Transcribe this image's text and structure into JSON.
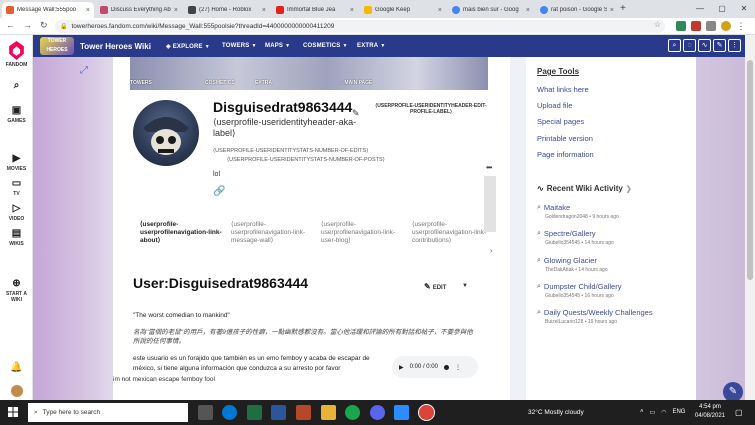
{
  "browser": {
    "tabs": [
      {
        "label": "Message Wall:555poo",
        "color": "#e65c2c",
        "active": true
      },
      {
        "label": "Discuss Everything Ab",
        "color": "#c14a6a",
        "active": false
      },
      {
        "label": "(27) Home - Roblox",
        "color": "#444444",
        "active": false
      },
      {
        "label": "Immortal Blue Jea",
        "color": "#e62117",
        "active": false
      },
      {
        "label": "Google Keep",
        "color": "#f6b800",
        "active": false
      },
      {
        "label": "mais bien sur - Goog",
        "color": "#4285f4",
        "active": false
      },
      {
        "label": "rat poison - Google S",
        "color": "#4285f4",
        "active": false
      }
    ],
    "url": "towerheroes.fandom.com/wiki/Message_Wall:555poolsie?threadId=4400000000000411209"
  },
  "fandom_rail": {
    "logo_text": "FANDOM",
    "items": [
      {
        "label": "GAMES",
        "icon": "gamepad-icon"
      },
      {
        "label": "MOVIES",
        "icon": "movie-icon"
      },
      {
        "label": "TV",
        "icon": "tv-icon"
      },
      {
        "label": "VIDEO",
        "icon": "video-icon"
      },
      {
        "label": "WIKIS",
        "icon": "wikis-icon"
      },
      {
        "label": "START A WIKI",
        "icon": "plus-circle-icon"
      }
    ]
  },
  "wiki": {
    "name": "Tower Heroes Wiki",
    "logo_text": "TOWER HEROES",
    "nav": [
      "EXPLORE",
      "TOWERS",
      "MAPS",
      "COSMETICS",
      "EXTRA"
    ]
  },
  "profile": {
    "banner_tabs": [
      "TOWERS",
      "COSMETICS",
      "EXTRA",
      "MAIN PAGE"
    ],
    "username": "Disguisedrat9863444",
    "aka_label": "⟨userprofile-useridentityheader-aka-label⟩",
    "edit_label": "⟨USERPROFILE-USERIDENTITYHEADER-EDIT-PROFILE-LABEL⟩",
    "stats_edits": "⟨USERPROFILE-USERIDENTITYSTATS-NUMBER-OF-EDITS⟩",
    "stats_posts": "⟨USERPROFILE-USERIDENTITYSTATS-NUMBER-OF-POSTS⟩",
    "bio": "lol",
    "nav": [
      "⟨userprofile-userprofilenavigation-link-about⟩",
      "⟨userprofile-userprofilenavigation-link-message-wall⟩",
      "⟨userprofile-userprofilenavigation-link-user-blog⟩",
      "⟨userprofile-userprofilenavigation-link-contributions⟩"
    ]
  },
  "page": {
    "title": "User:Disguisedrat9863444",
    "edit_label": "EDIT",
    "quote": "\"The worst comedian to mankind\"",
    "chinese": "名為\"當個的老鼠\"的用戶，有著9億孩子的性癖，一點幽默感都沒有。當心他活躍和評論的所有對話和帖子，不要參與他所說的任何事情。",
    "spanish": "este usuario es un forajido que también es un emo femboy y acaba de escapar de méxico, si tiene alguna información que conduzca a su arresto por favor",
    "audio_time": "0:00 / 0:00",
    "footnote": "im not mexican escape femboy fool"
  },
  "page_tools": {
    "title": "Page Tools",
    "links": [
      "What links here",
      "Upload file",
      "Special pages",
      "Printable version",
      "Page information"
    ]
  },
  "recent_activity": {
    "title": "Recent Wiki Activity",
    "items": [
      {
        "title": "Maitake",
        "meta": "Goldendragon2048 • 9 hours ago"
      },
      {
        "title": "Spectre/Gallery",
        "meta": "Giubello354545 • 14 hours ago"
      },
      {
        "title": "Glowing Glacier",
        "meta": "TheDakAttak • 14 hours ago"
      },
      {
        "title": "Dumpster Child/Gallery",
        "meta": "Giubello354545 • 16 hours ago"
      },
      {
        "title": "Daily Quests/Weekly Challenges",
        "meta": "BuizelLucario128 • 19 hours ago"
      }
    ]
  },
  "taskbar": {
    "search_placeholder": "Type here to search",
    "weather": "32°C  Mostly cloudy",
    "lang": "ENG",
    "time": "4:54 pm",
    "date": "04/08/2021"
  },
  "colors": {
    "wiki_header": "#2a3a8a",
    "link": "#3a4a9a",
    "fandom_logo": "#fa005a"
  }
}
